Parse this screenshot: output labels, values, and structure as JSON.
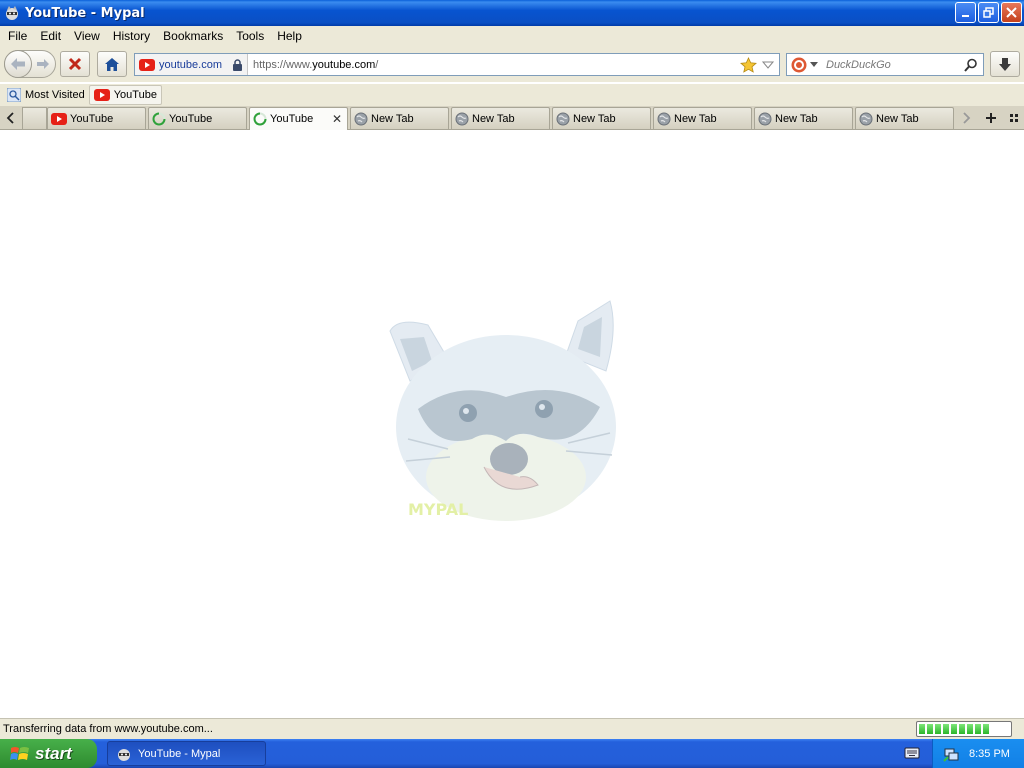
{
  "window": {
    "title": "YouTube - Mypal"
  },
  "menu": [
    "File",
    "Edit",
    "View",
    "History",
    "Bookmarks",
    "Tools",
    "Help"
  ],
  "nav": {
    "identity_label": "youtube.com",
    "url_prefix": "https://www.",
    "url_host": "youtube.com",
    "url_path": "/",
    "search_placeholder": "DuckDuckGo"
  },
  "bookmarks": [
    {
      "label": "Most Visited",
      "icon": "most-visited-icon"
    },
    {
      "label": "YouTube",
      "icon": "youtube-icon"
    }
  ],
  "tabs": [
    {
      "label": "YouTube",
      "icon": "youtube-icon",
      "selected": false
    },
    {
      "label": "YouTube",
      "icon": "loading-spinner-icon",
      "selected": false
    },
    {
      "label": "YouTube",
      "icon": "loading-spinner-icon",
      "selected": true
    },
    {
      "label": "New Tab",
      "icon": "globe-icon",
      "selected": false
    },
    {
      "label": "New Tab",
      "icon": "globe-icon",
      "selected": false
    },
    {
      "label": "New Tab",
      "icon": "globe-icon",
      "selected": false
    },
    {
      "label": "New Tab",
      "icon": "globe-icon",
      "selected": false
    },
    {
      "label": "New Tab",
      "icon": "globe-icon",
      "selected": false
    },
    {
      "label": "New Tab",
      "icon": "globe-icon",
      "selected": false
    }
  ],
  "content": {
    "mascot_caption": "MYPAL",
    "mascot_icon": "raccoon-mascot"
  },
  "status": {
    "text": "Transferring data from www.youtube.com...",
    "progress_percent": 80
  },
  "taskbar": {
    "start_label": "start",
    "task_label": "YouTube - Mypal",
    "clock": "8:35 PM"
  },
  "colors": {
    "titlebar": "#0a4fc4",
    "chrome": "#ece9d8",
    "youtube_red": "#e62117",
    "start_green": "#3b9d3c",
    "taskbar_blue": "#245ed8"
  }
}
